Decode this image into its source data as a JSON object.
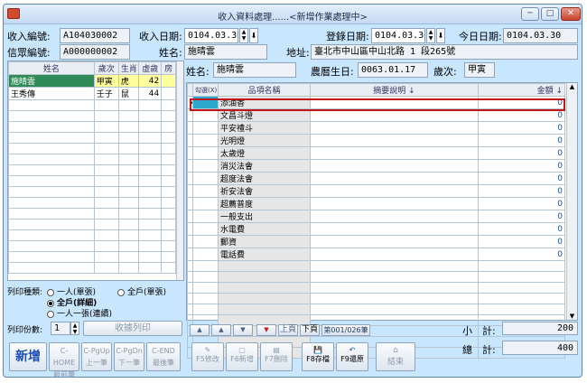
{
  "window": {
    "title": "收入資料處理......<新增作業處理中>",
    "min_label": "─",
    "max_label": "□",
    "close_label": "✕"
  },
  "header": {
    "income_no_label": "收入編號:",
    "income_no": "A104030002",
    "income_date_label": "收入日期:",
    "income_date": "0104.03.30",
    "reg_date_label": "登錄日期:",
    "reg_date": "0104.03.30",
    "today_label": "今日日期:",
    "today": "0104.03.30",
    "believer_no_label": "信眾編號:",
    "believer_no": "A000000002",
    "name_label": "姓名:",
    "name": "施晴雲",
    "address_label": "地址:",
    "address": "臺北市中山區中山北路 1 段265號"
  },
  "people_table": {
    "columns": [
      "姓名",
      "歲次",
      "生肖",
      "虛歲",
      "房"
    ],
    "rows": [
      {
        "name": "施晴雲",
        "year": "甲寅",
        "zodiac": "虎",
        "age": "42",
        "room": ""
      },
      {
        "name": "王秀傳",
        "year": "壬子",
        "zodiac": "鼠",
        "age": "44",
        "room": ""
      }
    ]
  },
  "print": {
    "type_label": "列印種類:",
    "options": [
      "一人(單張)",
      "全戶(單張)",
      "全戶(詳細)",
      "一人一張(連續)"
    ],
    "selected": "全戶(詳細)",
    "copies_label": "列印份數:",
    "copies": "1",
    "receipt_button": "收據列印"
  },
  "detail": {
    "name_label": "姓名:",
    "name": "施晴雲",
    "birth_label": "農曆生日:",
    "birth": "0063.01.17",
    "year_label": "歲次:",
    "year": "甲寅",
    "columns": [
      "勾選(X)",
      "品項名稱",
      "摘要說明 ↓",
      "金額 ↓"
    ],
    "items": [
      {
        "name": "添油香",
        "amount": "0"
      },
      {
        "name": "文昌斗燈",
        "amount": "0"
      },
      {
        "name": "平安禮斗",
        "amount": "0"
      },
      {
        "name": "光明燈",
        "amount": "0"
      },
      {
        "name": "太歲燈",
        "amount": "0"
      },
      {
        "name": "消災法會",
        "amount": "0"
      },
      {
        "name": "超度法會",
        "amount": "0"
      },
      {
        "name": "祈安法會",
        "amount": "0"
      },
      {
        "name": "超薦普度",
        "amount": "0"
      },
      {
        "name": "一般支出",
        "amount": "0"
      },
      {
        "name": "水電費",
        "amount": "0"
      },
      {
        "name": "郵資",
        "amount": "0"
      },
      {
        "name": "電話費",
        "amount": "0"
      }
    ],
    "empty_rows": 9
  },
  "nav": {
    "prev_page": "上頁",
    "next_page": "下頁",
    "page_status": "第001/026筆"
  },
  "totals": {
    "subtotal_label": "小　計:",
    "subtotal": "200",
    "total_label": "總　計:",
    "total": "400"
  },
  "buttons": {
    "new": "新增",
    "first": [
      "C-HOME",
      "最前筆"
    ],
    "prev": [
      "C-PgUp",
      "上一筆"
    ],
    "next": [
      "C-PgDn",
      "下一筆"
    ],
    "last": [
      "C-END",
      "最後筆"
    ],
    "edit": "F5修改",
    "add": "F6新增",
    "delete": "F7刪除",
    "save": "F8存檔",
    "restore": "F9還原",
    "exit": "結束"
  }
}
